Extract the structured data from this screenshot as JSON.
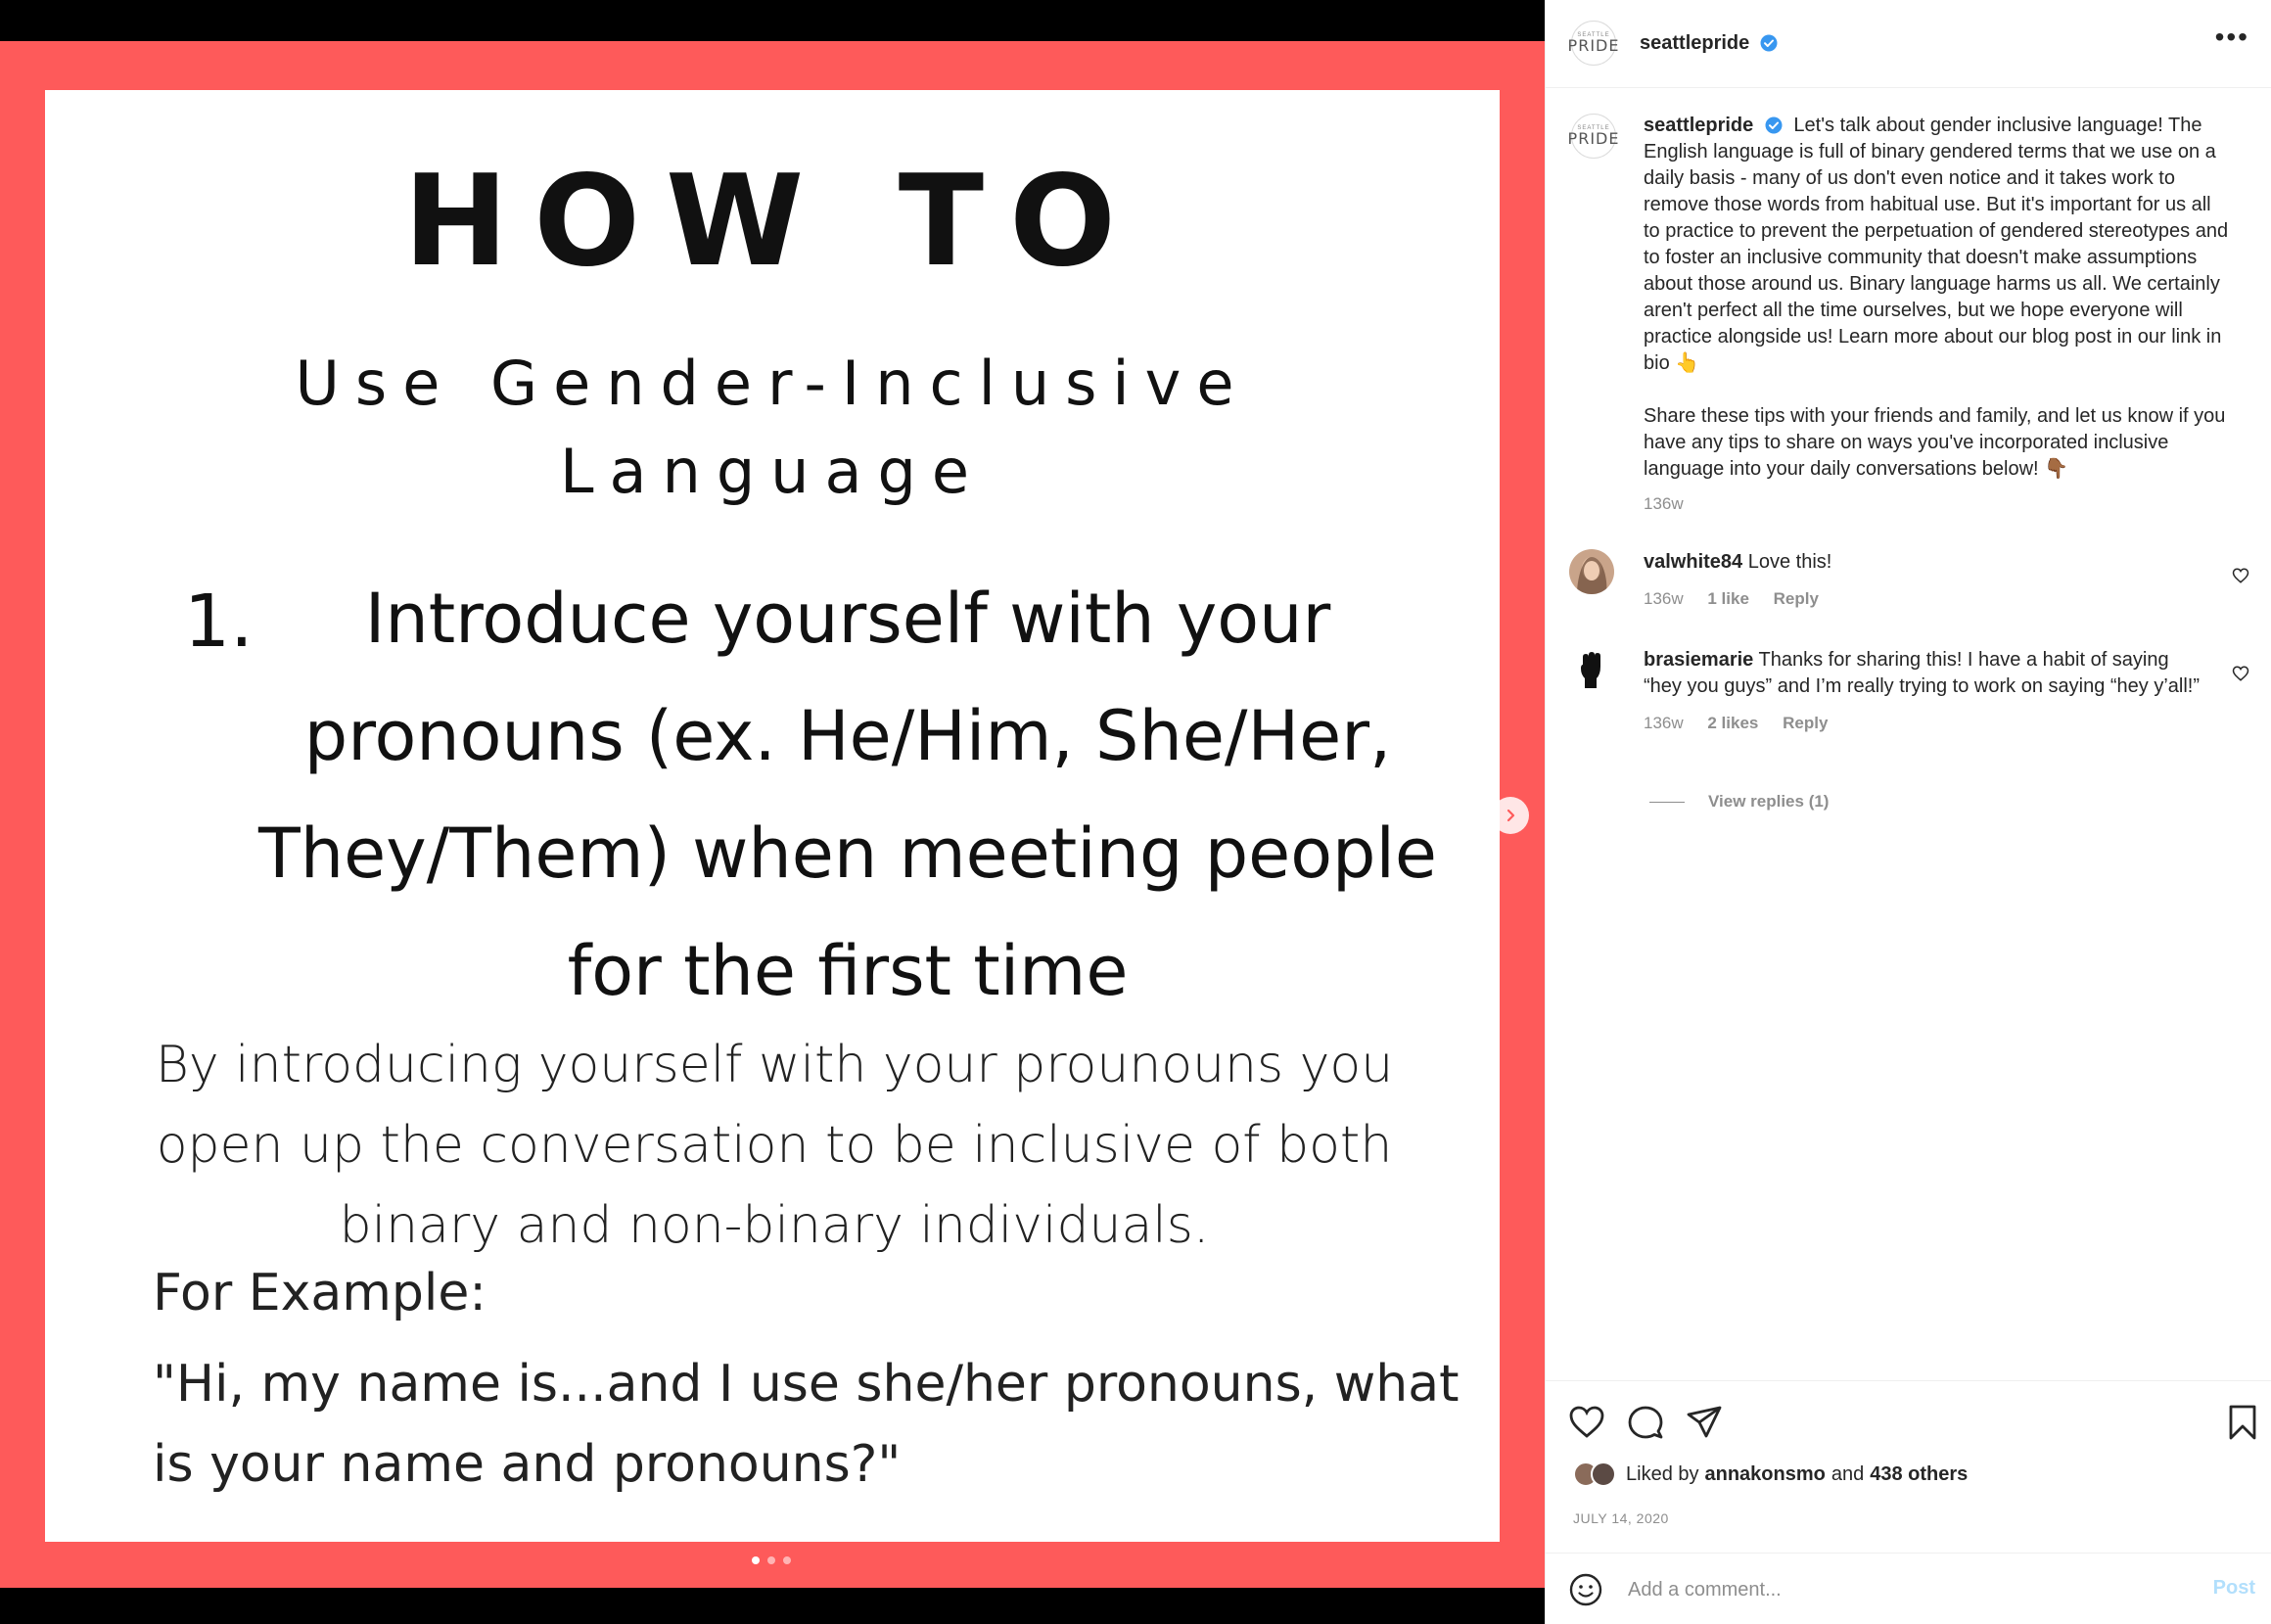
{
  "post": {
    "slide": {
      "heading": "HOW TO",
      "subtitle": "Use Gender-Inclusive Language",
      "tip_number": "1.",
      "tip_text": "Introduce yourself with your pronouns (ex. He/Him, She/Her, They/Them) when meeting people for the first time",
      "body": "By introducing yourself with your prounouns you open up the conversation to be inclusive of both binary and non-binary individuals.",
      "example_label": "For Example:",
      "example_quote": "\"Hi, my name is...and I use she/her pronouns, what is your name and pronouns?\"",
      "slide_count": 3,
      "active_slide": 1
    }
  },
  "header": {
    "username": "seattlepride",
    "avatar_small_text": "SEATTLE",
    "avatar_big_text": "PRIDE",
    "more_label": "•••"
  },
  "caption": {
    "username": "seattlepride",
    "paragraph1": "Let's talk about gender inclusive language! The English language is full of binary gendered terms that we use on a daily basis - many of us don't even notice and it takes work to remove those words from habitual use. But it's important for us all to practice to prevent the perpetuation of gendered stereotypes and to foster an inclusive community that doesn't make assumptions about those around us. Binary language harms us all. We certainly aren't perfect all the time ourselves, but we hope everyone will practice alongside us! Learn more about our blog post in our link in bio 👆",
    "paragraph2": "Share these tips with your friends and family, and let us know if you have any tips to share on ways you've incorporated inclusive language into your daily conversations below! 👇🏾",
    "age": "136w"
  },
  "comments": [
    {
      "username": "valwhite84",
      "text": "Love this!",
      "age": "136w",
      "likes": "1 like",
      "reply": "Reply"
    },
    {
      "username": "brasiemarie",
      "text": "Thanks for sharing this! I have a habit of saying “hey you guys” and I’m really trying to work on saying “hey y’all!”",
      "age": "136w",
      "likes": "2 likes",
      "reply": "Reply"
    }
  ],
  "view_replies": "View replies (1)",
  "likes": {
    "prefix": "Liked by",
    "user": "annakonsmo",
    "and": "and",
    "others": "438 others"
  },
  "date": "JULY 14, 2020",
  "comment_box": {
    "placeholder": "Add a comment...",
    "post_label": "Post"
  },
  "colors": {
    "slide_background": "#fe5a5a",
    "verified_blue": "#3897f0",
    "post_disabled": "#b2dffc"
  }
}
